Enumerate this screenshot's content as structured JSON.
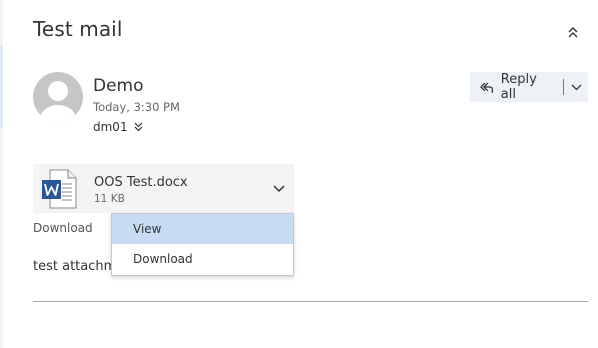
{
  "message": {
    "subject": "Test mail",
    "sender_name": "Demo",
    "timestamp": "Today, 3:30 PM",
    "recipients": "dm01",
    "body_preview": "test attachm"
  },
  "actions": {
    "reply_all_label": "Reply all"
  },
  "attachment": {
    "file_name": "OOS Test.docx",
    "file_size": "11 KB",
    "download_label": "Download"
  },
  "attachment_menu": {
    "items": [
      {
        "label": "View"
      },
      {
        "label": "Download"
      }
    ]
  },
  "icons": {
    "collapse": "double-chevron-up-icon",
    "expand_recipients": "double-chevron-down-icon",
    "reply_all": "reply-all-icon",
    "dropdown": "chevron-down-icon",
    "attachment": "word-document-icon",
    "avatar": "person-avatar-icon"
  },
  "colors": {
    "accent_hover": "#c7dcf2",
    "button_bg": "#eef2f6",
    "attachment_bg": "#f4f4f4",
    "word_blue": "#2b579a"
  }
}
